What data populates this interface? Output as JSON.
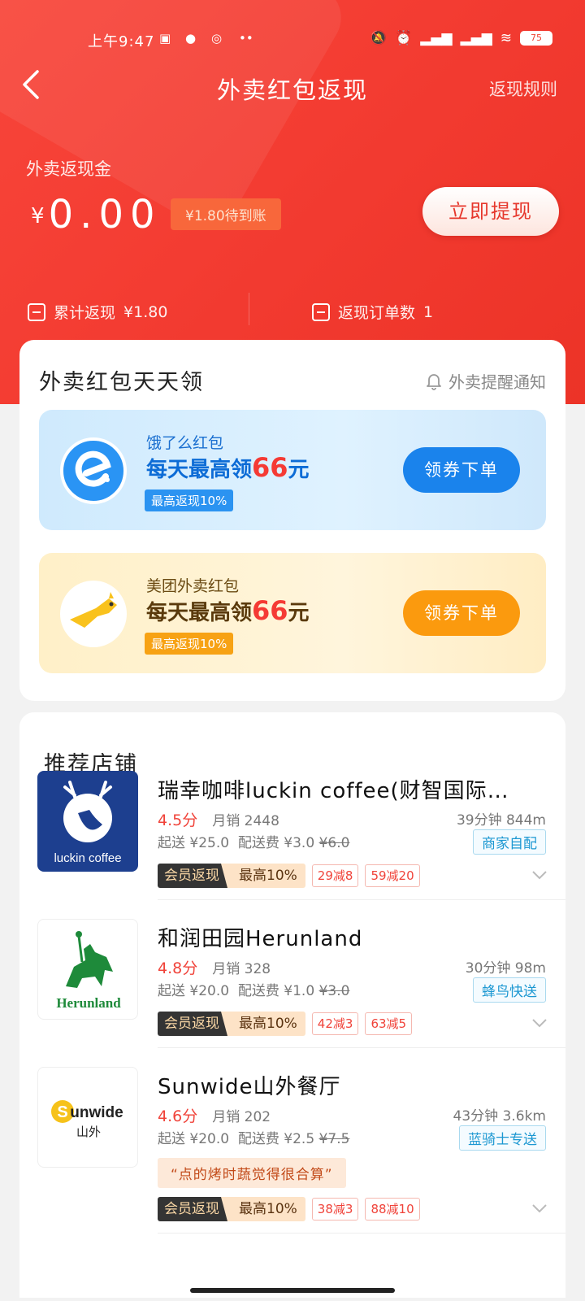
{
  "status": {
    "time": "上午9:47",
    "battery": "75"
  },
  "nav": {
    "back_icon": "chevron-left",
    "title": "外卖红包返现",
    "rules": "返现规则"
  },
  "balance": {
    "label": "外卖返现金",
    "currency": "¥",
    "amount": "0.00",
    "pending": "¥1.80待到账",
    "withdraw": "立即提现"
  },
  "stats": {
    "total_label": "累计返现",
    "total_value": "¥1.80",
    "orders_label": "返现订单数",
    "orders_value": "1"
  },
  "daily": {
    "title": "外卖红包天天领",
    "notify": "外卖提醒通知",
    "promos": [
      {
        "brand": "饿了么红包",
        "headline_pre": "每天最高领",
        "headline_num": "66",
        "headline_unit": "元",
        "badge": "最高返现10%",
        "button": "领券下单"
      },
      {
        "brand": "美团外卖红包",
        "headline_pre": "每天最高领",
        "headline_num": "66",
        "headline_unit": "元",
        "badge": "最高返现10%",
        "button": "领券下单"
      }
    ]
  },
  "shops": {
    "title": "推荐店铺",
    "items": [
      {
        "name": "瑞幸咖啡luckin coffee(财智国际…",
        "logo_text": "luckin coffee",
        "rating": "4.5分",
        "sales": "月销 2448",
        "eta": "39分钟 844m",
        "min_order": "起送 ¥25.0",
        "fee_label": "配送费 ¥3.0",
        "fee_old": "¥6.0",
        "delivery": "商家自配",
        "vip_a": "会员返现",
        "vip_b": "最高10%",
        "coupons": [
          "29减8",
          "59减20"
        ]
      },
      {
        "name": "和润田园Herunland",
        "logo_text": "Herunland",
        "rating": "4.8分",
        "sales": "月销 328",
        "eta": "30分钟 98m",
        "min_order": "起送 ¥20.0",
        "fee_label": "配送费 ¥1.0",
        "fee_old": "¥3.0",
        "delivery": "蜂鸟快送",
        "vip_a": "会员返现",
        "vip_b": "最高10%",
        "coupons": [
          "42减3",
          "63减5"
        ]
      },
      {
        "name": "Sunwide山外餐厅",
        "logo_text": "unwide",
        "logo_sub": "山外",
        "rating": "4.6分",
        "sales": "月销 202",
        "eta": "43分钟 3.6km",
        "min_order": "起送 ¥20.0",
        "fee_label": "配送费 ¥2.5",
        "fee_old": "¥7.5",
        "delivery": "蓝骑士专送",
        "review": "“点的烤时蔬觉得很合算”",
        "vip_a": "会员返现",
        "vip_b": "最高10%",
        "coupons": [
          "38减3",
          "88减10"
        ]
      }
    ]
  }
}
